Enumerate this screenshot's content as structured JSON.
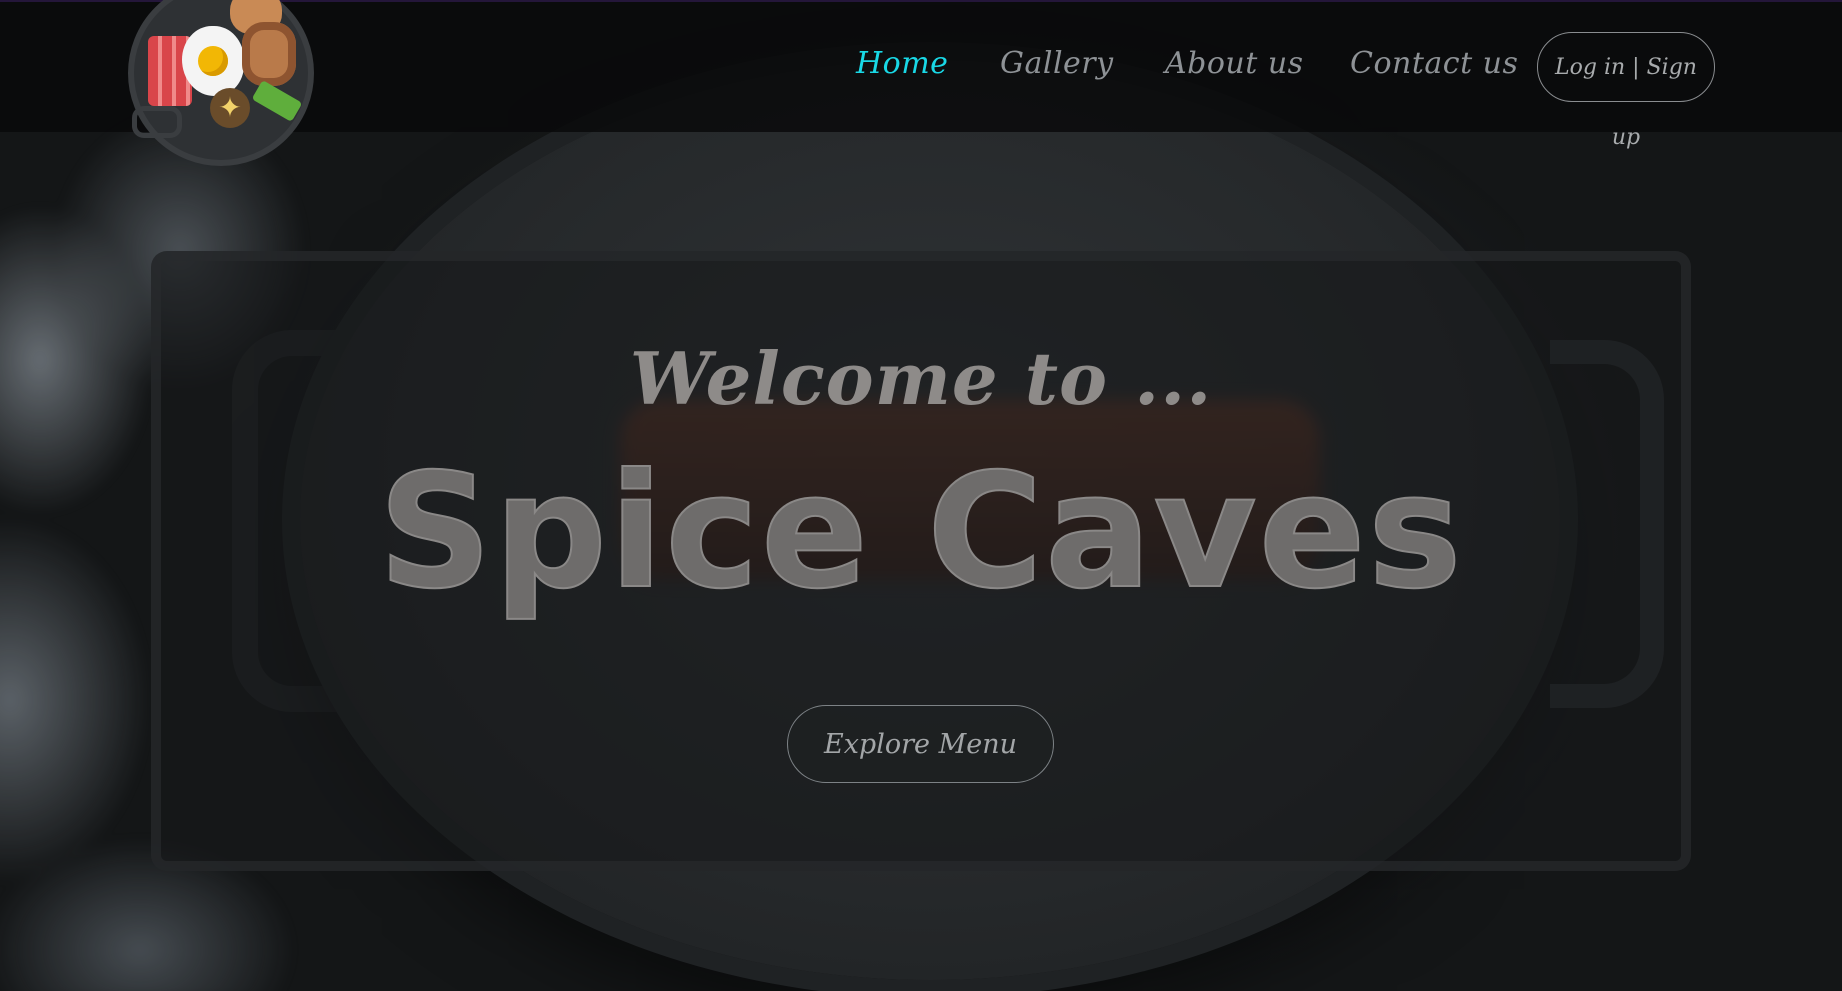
{
  "header": {
    "nav": [
      {
        "label": "Home",
        "active": true
      },
      {
        "label": "Gallery",
        "active": false
      },
      {
        "label": "About us",
        "active": false
      },
      {
        "label": "Contact us",
        "active": false
      }
    ],
    "login_label": "Log in | Sign up"
  },
  "hero": {
    "welcome": "Welcome to ...",
    "title": "Spice Caves",
    "explore_label": "Explore Menu"
  },
  "colors": {
    "accent_active_nav": "#19d8e6",
    "header_bg": "#08090a"
  },
  "icons": {
    "logo": "breakfast-pan-logo-icon"
  }
}
